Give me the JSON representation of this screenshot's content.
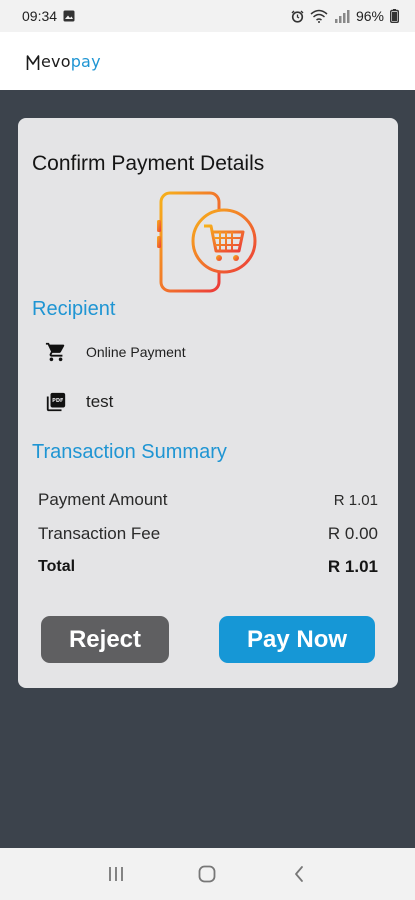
{
  "status_bar": {
    "time": "09:34",
    "battery": "96%",
    "icons": [
      "gallery-icon",
      "alarm-icon",
      "wifi-icon",
      "signal-icon",
      "battery-icon"
    ]
  },
  "header": {
    "logo_m": "M",
    "logo_evo": "evo",
    "logo_pay": "pay"
  },
  "card": {
    "title": "Confirm Payment Details",
    "hero_icon": "phone-cart-icon",
    "recipient": {
      "title": "Recipient",
      "rows": [
        {
          "icon": "cart-icon",
          "text": "Online Payment"
        },
        {
          "icon": "pdf-icon",
          "text": "test"
        }
      ]
    },
    "summary": {
      "title": "Transaction Summary",
      "rows": [
        {
          "label": "Payment Amount",
          "amount": "R 1.01"
        },
        {
          "label": "Transaction Fee",
          "amount": "R 0.00"
        },
        {
          "label": "Total",
          "amount": "R 1.01"
        }
      ]
    },
    "buttons": {
      "reject": "Reject",
      "pay": "Pay Now"
    }
  },
  "colors": {
    "accent": "#1f95d3",
    "pay_button": "#1697d6",
    "reject_button": "#5f5f61",
    "card_bg": "#e4e4e6",
    "page_bg": "#3c434c",
    "hero_gradient_start": "#f7b21b",
    "hero_gradient_end": "#ec3a3a"
  },
  "nav_bar": {
    "icons": [
      "recents-icon",
      "home-icon",
      "back-icon"
    ]
  }
}
